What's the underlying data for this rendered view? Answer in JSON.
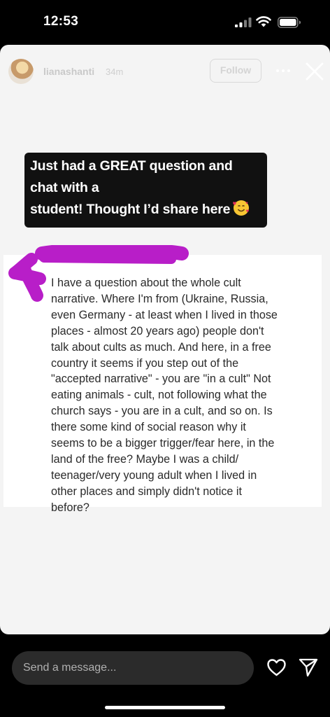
{
  "status_bar": {
    "time": "12:53",
    "signal_icon": "cellular-signal-icon",
    "wifi_icon": "wifi-icon",
    "battery_icon": "battery-icon"
  },
  "story": {
    "header": {
      "username": "lianashanti",
      "time_ago": "34m",
      "follow_label": "Follow",
      "more_icon": "more-dots-icon",
      "close_icon": "close-icon"
    },
    "caption": {
      "line1": "Just had a GREAT question and chat with a",
      "line2": "student! Thought I’d share here",
      "emoji": "🥰"
    },
    "question_text": "I have a question about the whole cult\nnarrative. Where I'm from (Ukraine, Russia,\neven Germany - at least when I lived in those\nplaces - almost 20 years ago) people don't\ntalk about cults as much. And here, in a free\ncountry it seems if you step out of the\n\"accepted narrative\" - you are \"in a cult\" Not\neating animals - cult, not following what the\nchurch says - you are in a cult, and so on. Is\nthere some kind of social reason why it\nseems to be a bigger trigger/fear here, in the\nland of the free? Maybe I was a child/\nteenager/very young adult when I lived in\nother places and simply didn't notice it\nbefore?"
  },
  "bottom_bar": {
    "message_placeholder": "Send a message...",
    "heart_icon": "heart-icon",
    "send_icon": "send-icon"
  },
  "colors": {
    "scribble": "#b81ec8",
    "story_background": "#f4f4f4",
    "caption_background": "#111111"
  }
}
